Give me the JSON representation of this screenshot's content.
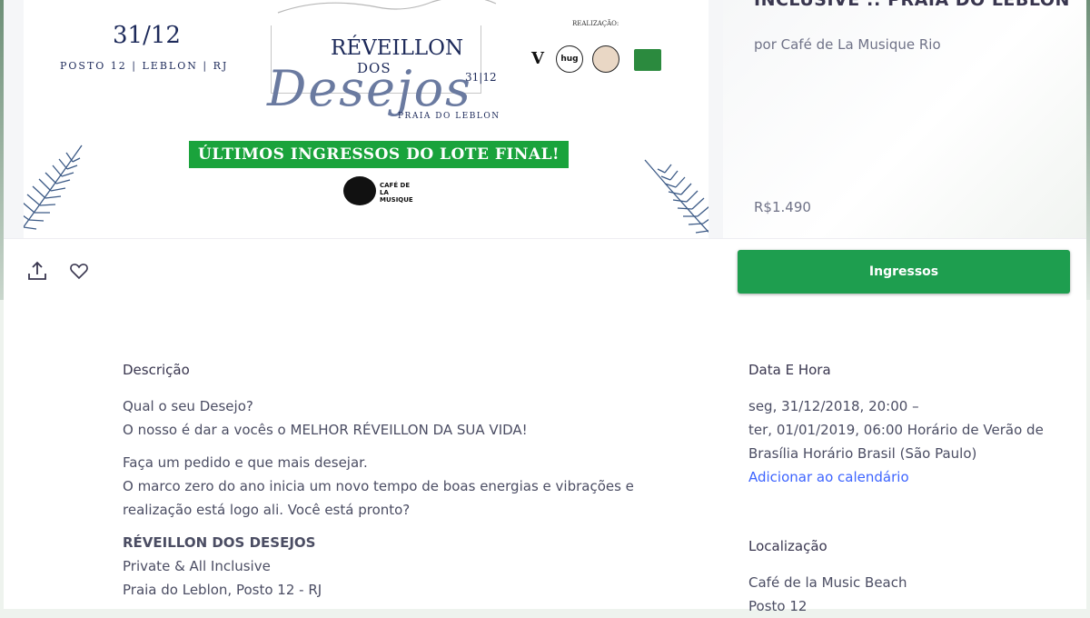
{
  "banner": {
    "date": "31/12",
    "place": "POSTO 12 | LEBLON | RJ",
    "title_main": "RÉVEILLON",
    "title_dos": "DOS",
    "title_script": "Desejos",
    "title_date": "31|12",
    "title_sub": "PRAIA DO LEBLON",
    "realizacao_label": "REALIZAÇÃO:",
    "partner_logos": [
      "logo-v",
      "hug",
      "face",
      "logo-box"
    ],
    "green_band": "ÚLTIMOS INGRESSOS  DO LOTE FINAL!",
    "footer_logo_text": "CAFÉ DE LA MUSIQUE",
    "colors": {
      "navy": "#1d2a5a",
      "band": "#1aa33c"
    }
  },
  "event": {
    "title": "INCLUSIVE :: PRAIA DO LEBLON",
    "organizer": "por Café de La Musique Rio",
    "price": "R$1.490"
  },
  "actions": {
    "share_icon": "share-icon",
    "like_icon": "heart-icon",
    "tickets_label": "Ingressos",
    "tickets_color": "#1e9e4f"
  },
  "description": {
    "heading": "Descrição",
    "p1_line1": "Qual o seu Desejo?",
    "p1_line2": "O nosso é dar a vocês o MELHOR RÉVEILLON DA SUA VIDA!",
    "p2_line1": "Faça um pedido e que mais desejar.",
    "p2_line2": "O marco zero do ano inicia um novo tempo de boas energias e vibrações e",
    "p2_line3": "realização está logo ali. Você está pronto?",
    "event_name": "RÉVEILLON DOS DESEJOS",
    "line_private": "Private & All Inclusive",
    "line_place": "Praia do Leblon, Posto 12 - RJ"
  },
  "datetime": {
    "heading": "Data E Hora",
    "line1": "seg, 31/12/2018, 20:00 –",
    "line2": "ter, 01/01/2019, 06:00 Horário de Verão de",
    "line3": "Brasília Horário Brasil (São Paulo)",
    "add_calendar": "Adicionar ao calendário"
  },
  "location": {
    "heading": "Localização",
    "line1": "Café de la Music Beach",
    "line2": "Posto 12"
  }
}
